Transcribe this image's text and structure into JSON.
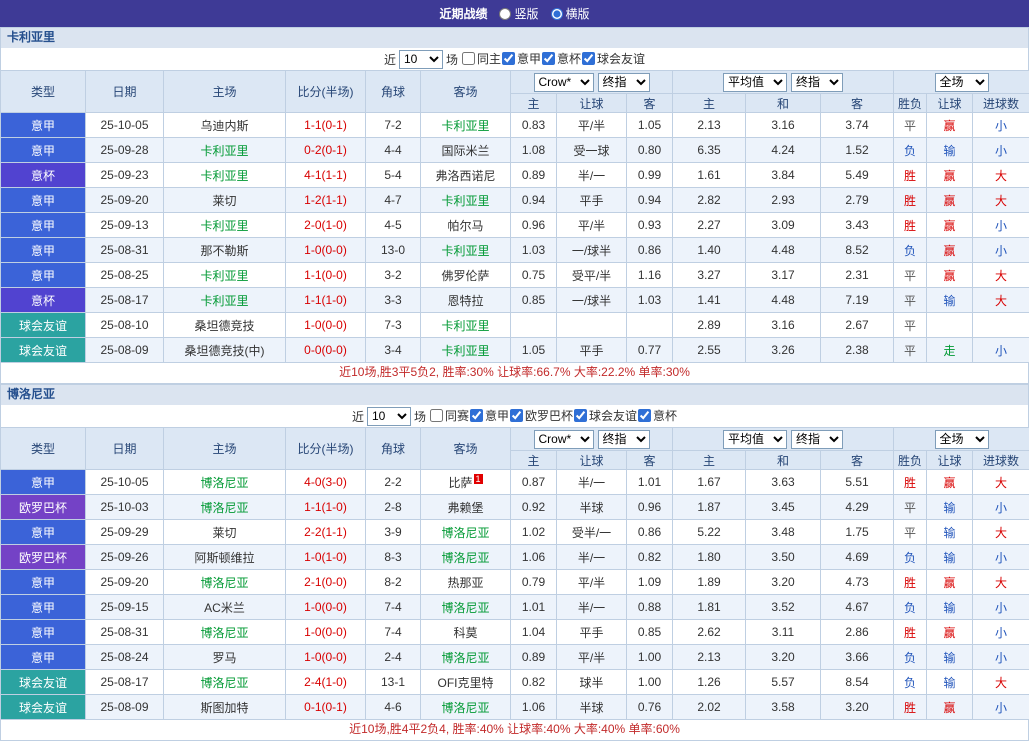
{
  "topbar": {
    "title": "近期战绩",
    "vertical_label": "竖版",
    "horizontal_label": "横版",
    "selected": "横版"
  },
  "controls": {
    "near_label": "近",
    "games_value": "10",
    "games_suffix": "场"
  },
  "header": {
    "cols": [
      "类型",
      "日期",
      "主场",
      "比分(半场)",
      "角球",
      "客场"
    ],
    "odds_group": [
      "主",
      "让球",
      "客"
    ],
    "avg_group": [
      "主",
      "和",
      "客"
    ],
    "full_group": [
      "胜负",
      "让球",
      "进球数"
    ],
    "selects": {
      "bookmaker": "Crow*",
      "final_odds": "终指",
      "average": "平均值",
      "scope": "全场"
    }
  },
  "colors": {
    "topbar_bg": "#3E3A96",
    "team_green": "#009933",
    "score_red": "#D80000",
    "summary_red": "#C22A2A",
    "header_bg": "#DCE7F4"
  },
  "league_colors": {
    "意甲": "#3B63D8",
    "意杯": "#5143D0",
    "欧罗巴杯": "#7442C6",
    "球会友谊": "#2BA3A1"
  },
  "result_colors": {
    "胜": "#D80000",
    "负": "#2255BB",
    "平": "#555555",
    "赢": "#D80000",
    "输": "#2255BB",
    "走": "#009933",
    "大": "#D80000",
    "小": "#2255BB"
  },
  "sections": [
    {
      "team": "卡利亚里",
      "filters": [
        {
          "label": "同主",
          "checked": false
        },
        {
          "label": "意甲",
          "checked": true
        },
        {
          "label": "意杯",
          "checked": true
        },
        {
          "label": "球会友谊",
          "checked": true
        }
      ],
      "rows": [
        {
          "league": "意甲",
          "date": "25-10-05",
          "home": "乌迪内斯",
          "score": "1-1(0-1)",
          "corner": "7-2",
          "away": "卡利亚里",
          "away_card": "",
          "o1": "0.83",
          "hcap": "平/半",
          "o2": "1.05",
          "a1": "2.13",
          "a2": "3.16",
          "a3": "3.74",
          "res": "平",
          "hres": "赢",
          "goals": "小"
        },
        {
          "league": "意甲",
          "date": "25-09-28",
          "home": "卡利亚里",
          "score": "0-2(0-1)",
          "corner": "4-4",
          "away": "国际米兰",
          "away_card": "",
          "o1": "1.08",
          "hcap": "受一球",
          "o2": "0.80",
          "a1": "6.35",
          "a2": "4.24",
          "a3": "1.52",
          "res": "负",
          "hres": "输",
          "goals": "小"
        },
        {
          "league": "意杯",
          "date": "25-09-23",
          "home": "卡利亚里",
          "score": "4-1(1-1)",
          "corner": "5-4",
          "away": "弗洛西诺尼",
          "away_card": "",
          "o1": "0.89",
          "hcap": "半/一",
          "o2": "0.99",
          "a1": "1.61",
          "a2": "3.84",
          "a3": "5.49",
          "res": "胜",
          "hres": "赢",
          "goals": "大"
        },
        {
          "league": "意甲",
          "date": "25-09-20",
          "home": "莱切",
          "score": "1-2(1-1)",
          "corner": "4-7",
          "away": "卡利亚里",
          "away_card": "",
          "o1": "0.94",
          "hcap": "平手",
          "o2": "0.94",
          "a1": "2.82",
          "a2": "2.93",
          "a3": "2.79",
          "res": "胜",
          "hres": "赢",
          "goals": "大"
        },
        {
          "league": "意甲",
          "date": "25-09-13",
          "home": "卡利亚里",
          "score": "2-0(1-0)",
          "corner": "4-5",
          "away": "帕尔马",
          "away_card": "",
          "o1": "0.96",
          "hcap": "平/半",
          "o2": "0.93",
          "a1": "2.27",
          "a2": "3.09",
          "a3": "3.43",
          "res": "胜",
          "hres": "赢",
          "goals": "小"
        },
        {
          "league": "意甲",
          "date": "25-08-31",
          "home": "那不勒斯",
          "score": "1-0(0-0)",
          "corner": "13-0",
          "away": "卡利亚里",
          "away_card": "",
          "o1": "1.03",
          "hcap": "一/球半",
          "o2": "0.86",
          "a1": "1.40",
          "a2": "4.48",
          "a3": "8.52",
          "res": "负",
          "hres": "赢",
          "goals": "小"
        },
        {
          "league": "意甲",
          "date": "25-08-25",
          "home": "卡利亚里",
          "score": "1-1(0-0)",
          "corner": "3-2",
          "away": "佛罗伦萨",
          "away_card": "",
          "o1": "0.75",
          "hcap": "受平/半",
          "o2": "1.16",
          "a1": "3.27",
          "a2": "3.17",
          "a3": "2.31",
          "res": "平",
          "hres": "赢",
          "goals": "大"
        },
        {
          "league": "意杯",
          "date": "25-08-17",
          "home": "卡利亚里",
          "score": "1-1(1-0)",
          "corner": "3-3",
          "away": "恩特拉",
          "away_card": "",
          "o1": "0.85",
          "hcap": "一/球半",
          "o2": "1.03",
          "a1": "1.41",
          "a2": "4.48",
          "a3": "7.19",
          "res": "平",
          "hres": "输",
          "goals": "大"
        },
        {
          "league": "球会友谊",
          "date": "25-08-10",
          "home": "桑坦德竞技",
          "score": "1-0(0-0)",
          "corner": "7-3",
          "away": "卡利亚里",
          "away_card": "",
          "o1": "",
          "hcap": "",
          "o2": "",
          "a1": "2.89",
          "a2": "3.16",
          "a3": "2.67",
          "res": "平",
          "hres": "",
          "goals": ""
        },
        {
          "league": "球会友谊",
          "date": "25-08-09",
          "home": "桑坦德竞技(中)",
          "score": "0-0(0-0)",
          "corner": "3-4",
          "away": "卡利亚里",
          "away_card": "",
          "o1": "1.05",
          "hcap": "平手",
          "o2": "0.77",
          "a1": "2.55",
          "a2": "3.26",
          "a3": "2.38",
          "res": "平",
          "hres": "走",
          "goals": "小"
        }
      ],
      "summary": "近10场,胜3平5负2, 胜率:30% 让球率:66.7% 大率:22.2% 单率:30%"
    },
    {
      "team": "博洛尼亚",
      "filters": [
        {
          "label": "同赛",
          "checked": false
        },
        {
          "label": "意甲",
          "checked": true
        },
        {
          "label": "欧罗巴杯",
          "checked": true
        },
        {
          "label": "球会友谊",
          "checked": true
        },
        {
          "label": "意杯",
          "checked": true
        }
      ],
      "rows": [
        {
          "league": "意甲",
          "date": "25-10-05",
          "home": "博洛尼亚",
          "score": "4-0(3-0)",
          "corner": "2-2",
          "away": "比萨",
          "away_card": "1",
          "o1": "0.87",
          "hcap": "半/一",
          "o2": "1.01",
          "a1": "1.67",
          "a2": "3.63",
          "a3": "5.51",
          "res": "胜",
          "hres": "赢",
          "goals": "大"
        },
        {
          "league": "欧罗巴杯",
          "date": "25-10-03",
          "home": "博洛尼亚",
          "score": "1-1(1-0)",
          "corner": "2-8",
          "away": "弗赖堡",
          "away_card": "",
          "o1": "0.92",
          "hcap": "半球",
          "o2": "0.96",
          "a1": "1.87",
          "a2": "3.45",
          "a3": "4.29",
          "res": "平",
          "hres": "输",
          "goals": "小"
        },
        {
          "league": "意甲",
          "date": "25-09-29",
          "home": "莱切",
          "score": "2-2(1-1)",
          "corner": "3-9",
          "away": "博洛尼亚",
          "away_card": "",
          "o1": "1.02",
          "hcap": "受半/一",
          "o2": "0.86",
          "a1": "5.22",
          "a2": "3.48",
          "a3": "1.75",
          "res": "平",
          "hres": "输",
          "goals": "大"
        },
        {
          "league": "欧罗巴杯",
          "date": "25-09-26",
          "home": "阿斯顿维拉",
          "score": "1-0(1-0)",
          "corner": "8-3",
          "away": "博洛尼亚",
          "away_card": "",
          "o1": "1.06",
          "hcap": "半/一",
          "o2": "0.82",
          "a1": "1.80",
          "a2": "3.50",
          "a3": "4.69",
          "res": "负",
          "hres": "输",
          "goals": "小"
        },
        {
          "league": "意甲",
          "date": "25-09-20",
          "home": "博洛尼亚",
          "score": "2-1(0-0)",
          "corner": "8-2",
          "away": "热那亚",
          "away_card": "",
          "o1": "0.79",
          "hcap": "平/半",
          "o2": "1.09",
          "a1": "1.89",
          "a2": "3.20",
          "a3": "4.73",
          "res": "胜",
          "hres": "赢",
          "goals": "大"
        },
        {
          "league": "意甲",
          "date": "25-09-15",
          "home": "AC米兰",
          "score": "1-0(0-0)",
          "corner": "7-4",
          "away": "博洛尼亚",
          "away_card": "",
          "o1": "1.01",
          "hcap": "半/一",
          "o2": "0.88",
          "a1": "1.81",
          "a2": "3.52",
          "a3": "4.67",
          "res": "负",
          "hres": "输",
          "goals": "小"
        },
        {
          "league": "意甲",
          "date": "25-08-31",
          "home": "博洛尼亚",
          "score": "1-0(0-0)",
          "corner": "7-4",
          "away": "科莫",
          "away_card": "",
          "o1": "1.04",
          "hcap": "平手",
          "o2": "0.85",
          "a1": "2.62",
          "a2": "3.11",
          "a3": "2.86",
          "res": "胜",
          "hres": "赢",
          "goals": "小"
        },
        {
          "league": "意甲",
          "date": "25-08-24",
          "home": "罗马",
          "score": "1-0(0-0)",
          "corner": "2-4",
          "away": "博洛尼亚",
          "away_card": "",
          "o1": "0.89",
          "hcap": "平/半",
          "o2": "1.00",
          "a1": "2.13",
          "a2": "3.20",
          "a3": "3.66",
          "res": "负",
          "hres": "输",
          "goals": "小"
        },
        {
          "league": "球会友谊",
          "date": "25-08-17",
          "home": "博洛尼亚",
          "score": "2-4(1-0)",
          "corner": "13-1",
          "away": "OFI克里特",
          "away_card": "",
          "o1": "0.82",
          "hcap": "球半",
          "o2": "1.00",
          "a1": "1.26",
          "a2": "5.57",
          "a3": "8.54",
          "res": "负",
          "hres": "输",
          "goals": "大"
        },
        {
          "league": "球会友谊",
          "date": "25-08-09",
          "home": "斯图加特",
          "score": "0-1(0-1)",
          "corner": "4-6",
          "away": "博洛尼亚",
          "away_card": "",
          "o1": "1.06",
          "hcap": "半球",
          "o2": "0.76",
          "a1": "2.02",
          "a2": "3.58",
          "a3": "3.20",
          "res": "胜",
          "hres": "赢",
          "goals": "小"
        }
      ],
      "summary": "近10场,胜4平2负4, 胜率:40% 让球率:40% 大率:40% 单率:60%"
    }
  ]
}
